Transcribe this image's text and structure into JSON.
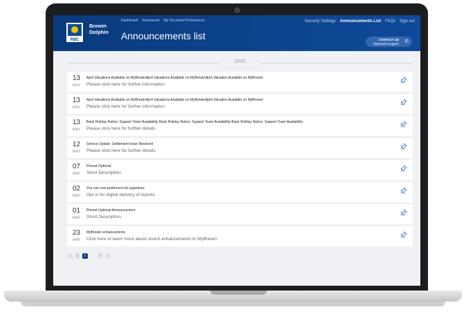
{
  "header": {
    "brand_line1": "Brewin",
    "brand_line2": "Dolphin",
    "logo_text": "RBC",
    "top_nav": [
      "Dashboard",
      "Documents",
      "My Document Preferences"
    ],
    "right_nav": [
      "Security Settings",
      "Announcements List",
      "FAQs",
      "Sign out"
    ],
    "right_nav_active": 1,
    "page_title": "Announcements list",
    "contact_line1": "CONTACT US",
    "contact_line2": "MyBrewin Support",
    "contact_icon": "phone-icon"
  },
  "year_label": "2025",
  "announcements": [
    {
      "day": "13",
      "month": "MAY",
      "title": "April Valuations Available on MyBrewinApril Valuations Available on MyBrewinApril Valuation Available on MyBrewin",
      "description": "Please click here for further information"
    },
    {
      "day": "13",
      "month": "MAY",
      "title": "April Valuations Available on MyBrewinApril Valuations Available on MyBrewinApril Valuation Available on MyBrewin",
      "description": "Please click here for further information"
    },
    {
      "day": "13",
      "month": "MAY",
      "title": "Bank Holiday Notice: Support Team Availability Bank Holiday Notice: Support Team Availability Bank Holiday Notice: Support Team Availability",
      "description": "Please click here for further details"
    },
    {
      "day": "12",
      "month": "MAY",
      "title": "Service Update: Settlement Issue Resolved",
      "description": "Please click here for further details"
    },
    {
      "day": "07",
      "month": "MAY",
      "title": "Pinned Optional",
      "description": "Short Description"
    },
    {
      "day": "02",
      "month": "MAY",
      "title": "You can now preference for paperless",
      "description": "Opt in for digital delivery of reports"
    },
    {
      "day": "01",
      "month": "MAY",
      "title": "Pinned Optional Announcement",
      "description": "Short Description"
    },
    {
      "day": "23",
      "month": "APR",
      "title": "MyBrewin enhancements",
      "description": "Click here to learn more about recent enhancements to MyBrewin"
    }
  ],
  "pin_icon": "pin-icon",
  "accent_color": "#0a3a7d",
  "pin_color": "#2b6cc4",
  "pagination": {
    "prev": "‹",
    "pages": [
      "1",
      "2",
      "",
      "7"
    ],
    "active_index": 1,
    "next": "›"
  }
}
